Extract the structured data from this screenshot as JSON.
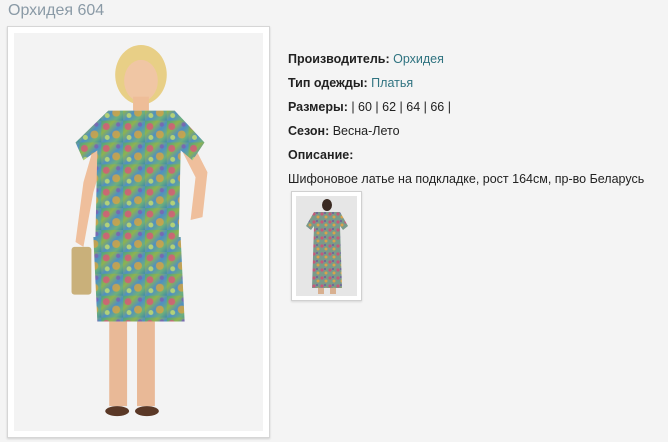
{
  "page": {
    "title": "Орхидея 604"
  },
  "details": {
    "manufacturer_label": "Производитель:",
    "manufacturer_value": "Орхидея",
    "type_label": "Тип одежды:",
    "type_value": "Платья",
    "sizes_label": "Размеры:",
    "sizes_value": "| 60 | 62 | 64 | 66 |",
    "season_label": "Сезон:",
    "season_value": "Весна-Лето",
    "description_label": "Описание:",
    "description_text": "Шифоновое латье на подкладке, рост 164см, пр-во Беларусь"
  },
  "colors": {
    "title": "#8a9aa6",
    "link": "#2f7380"
  }
}
